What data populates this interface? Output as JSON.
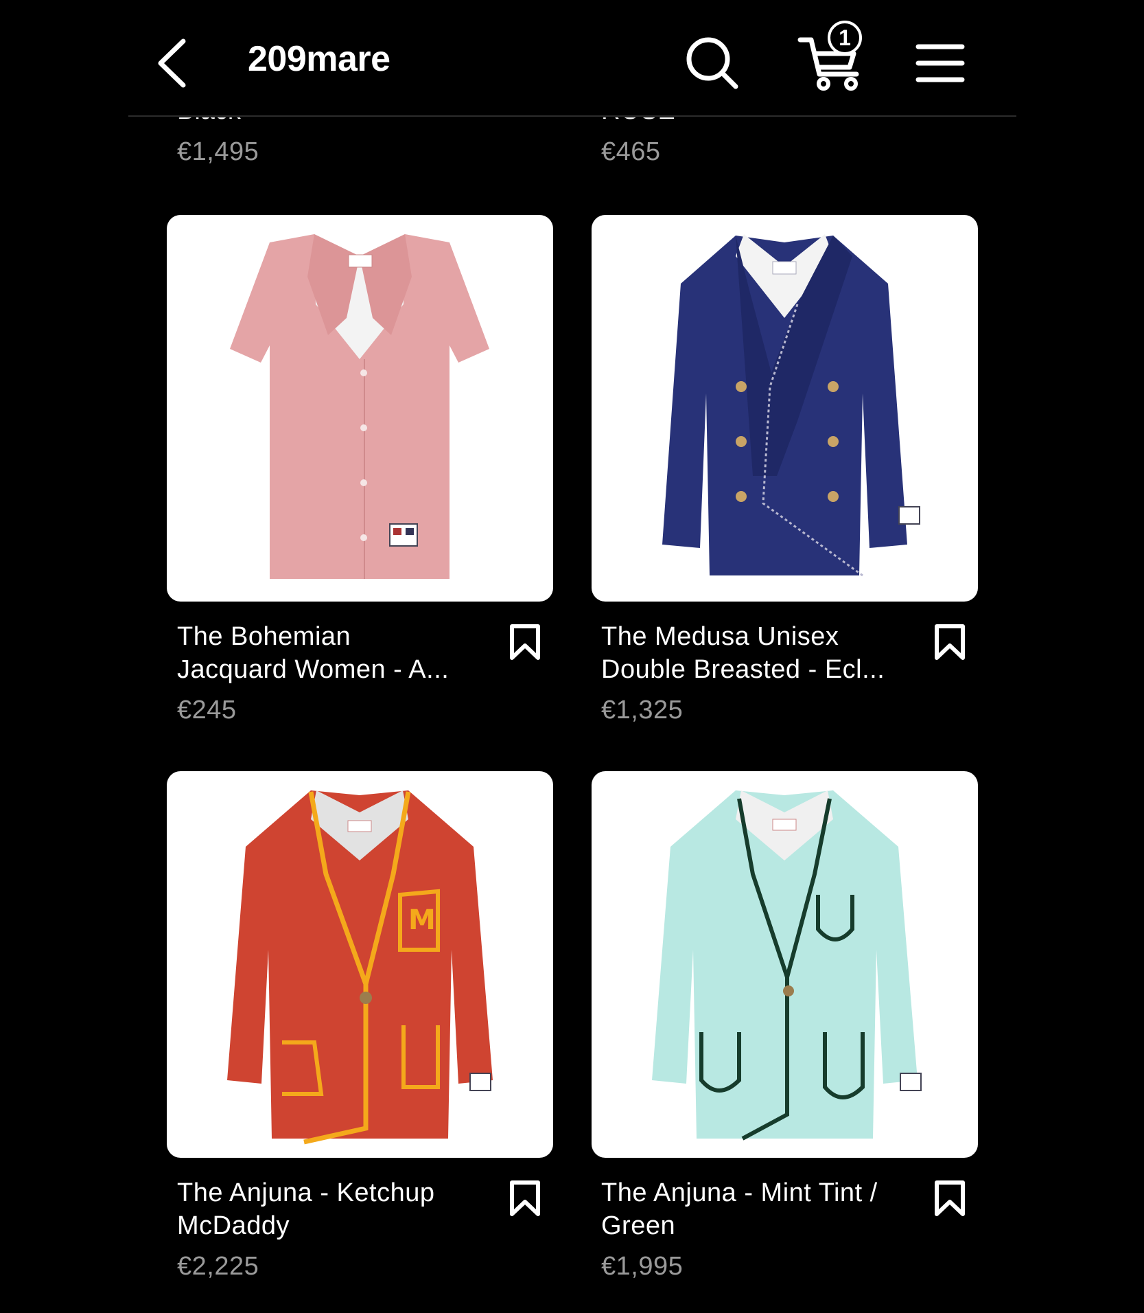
{
  "header": {
    "title": "209mare",
    "cart_count": "1"
  },
  "partial_row": [
    {
      "name": "Black",
      "price": "€1,495"
    },
    {
      "name": "ROSE",
      "price": "€465"
    }
  ],
  "products": [
    {
      "name_line1": "The Bohemian",
      "name_line2": "Jacquard Women - A...",
      "price": "€245"
    },
    {
      "name_line1": "The Medusa Unisex",
      "name_line2": "Double Breasted - Ecl...",
      "price": "€1,325"
    },
    {
      "name_line1": "The Anjuna - Ketchup",
      "name_line2": "McDaddy",
      "price": "€2,225"
    },
    {
      "name_line1": "The Anjuna - Mint Tint /",
      "name_line2": "Green",
      "price": "€1,995"
    }
  ],
  "colors": {
    "background": "#000000",
    "price_text": "#9a9a9a",
    "card_bg": "#ffffff"
  },
  "icons": [
    "back-arrow-icon",
    "search-icon",
    "cart-icon",
    "menu-icon",
    "bookmark-icon"
  ]
}
